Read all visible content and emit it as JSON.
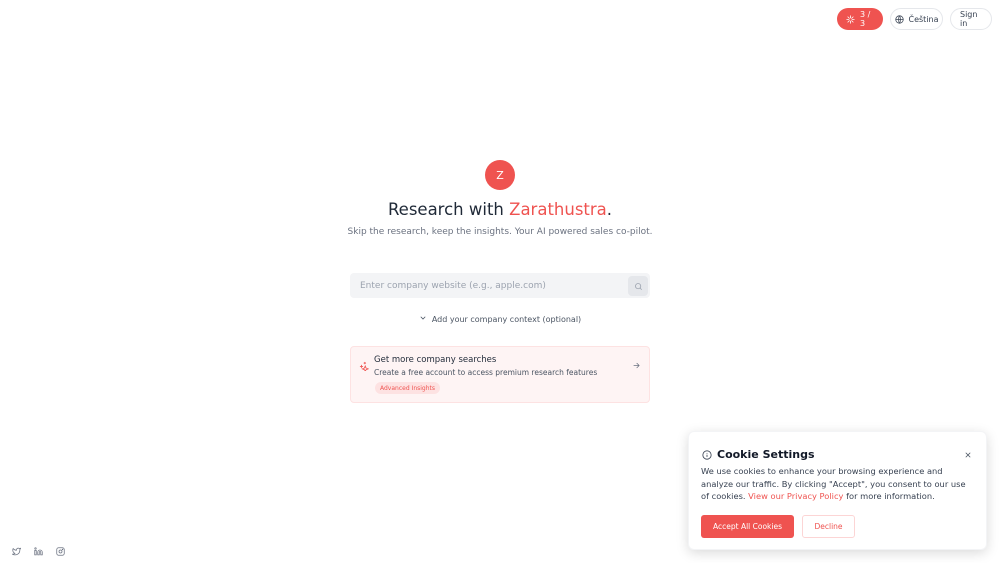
{
  "header": {
    "credits_label": "3 / 3",
    "credits_icon": "sparkle-icon",
    "language_label": "Čeština",
    "language_icon": "globe-icon",
    "signin_label": "Sign in"
  },
  "hero": {
    "logo_letter": "Z",
    "headline_prefix": "Research with ",
    "headline_brand": "Zarathustra",
    "headline_suffix": ".",
    "subtitle": "Skip the research, keep the insights. Your AI powered sales co-pilot."
  },
  "search": {
    "placeholder": "Enter company website (e.g., apple.com)",
    "value": "",
    "button_icon": "search-icon"
  },
  "context": {
    "label": "Add your company context (optional)",
    "icon": "chevron-down-icon"
  },
  "promo": {
    "icon": "sparkles-icon",
    "title": "Get more company searches",
    "description": "Create a free account to access premium research features",
    "badge": "Advanced Insights",
    "arrow_icon": "arrow-right-icon"
  },
  "social": {
    "icons": [
      "twitter-icon",
      "linkedin-icon",
      "instagram-icon"
    ]
  },
  "cookie": {
    "icon": "info-icon",
    "title": "Cookie Settings",
    "text_before": "We use cookies to enhance your browsing experience and analyze our traffic. By clicking \"Accept\", you consent to our use of cookies. ",
    "link_text": "View our Privacy Policy",
    "text_after": " for more information.",
    "accept_label": "Accept All Cookies",
    "decline_label": "Decline",
    "close_icon": "close-icon"
  },
  "colors": {
    "accent": "#ef5350",
    "promo_bg": "#fef4f4",
    "text_muted": "#6b7280"
  }
}
